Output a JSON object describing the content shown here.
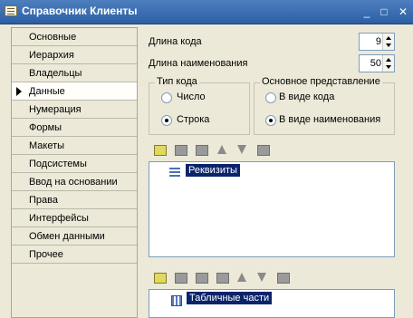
{
  "window": {
    "title": "Справочник Клиенты",
    "controls": {
      "minimize": "_",
      "maximize": "□",
      "close": "✕"
    }
  },
  "nav": {
    "items": [
      "Основные",
      "Иерархия",
      "Владельцы",
      "Данные",
      "Нумерация",
      "Формы",
      "Макеты",
      "Подсистемы",
      "Ввод на основании",
      "Права",
      "Интерфейсы",
      "Обмен данными",
      "Прочее"
    ],
    "active": "Данные"
  },
  "fields": {
    "code_length_label": "Длина кода",
    "code_length_value": "9",
    "name_length_label": "Длина наименования",
    "name_length_value": "50"
  },
  "code_type": {
    "title": "Тип кода",
    "options": [
      "Число",
      "Строка"
    ],
    "selected": "Строка"
  },
  "representation": {
    "title": "Основное представление",
    "options": [
      "В виде кода",
      "В виде наименования"
    ],
    "selected": "В виде наименования"
  },
  "attributes_tree": {
    "item": "Реквизиты",
    "icon": "attributes-icon"
  },
  "tabular_tree": {
    "item": "Табличные части",
    "icon": "tabular-sections-icon"
  },
  "colors": {
    "titlebar": "#2c5ea4",
    "selection": "#0a246a",
    "background": "#ece9d8"
  }
}
